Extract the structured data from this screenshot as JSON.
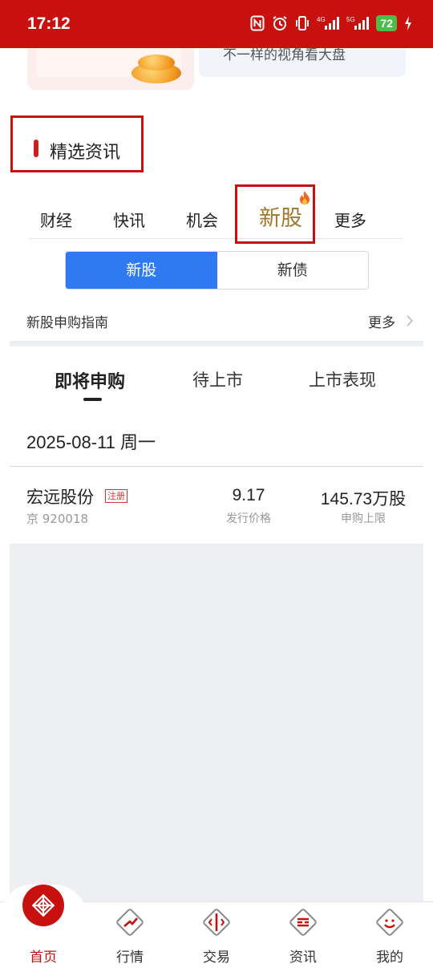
{
  "status_bar": {
    "time": "17:12",
    "battery": "72",
    "network_1": "4G",
    "network_2": "5G",
    "icons": [
      "nfc-icon",
      "alarm-icon",
      "vibrate-icon",
      "signal-icon",
      "signal-icon",
      "battery-icon",
      "charging-icon"
    ]
  },
  "banner": {
    "partial_text": "不一样的视角看大盘"
  },
  "section": {
    "title": "精选资讯"
  },
  "category_tabs": [
    {
      "label": "财经"
    },
    {
      "label": "快讯"
    },
    {
      "label": "机会"
    },
    {
      "label": "新股",
      "active": true,
      "badge_icon": "fire-icon"
    },
    {
      "label": "更多"
    }
  ],
  "segmented": {
    "options": [
      "新股",
      "新债"
    ],
    "selected": "新股"
  },
  "guide": {
    "label": "新股申购指南",
    "more": "更多"
  },
  "sub_tabs": {
    "items": [
      "即将申购",
      "待上市",
      "上市表现"
    ],
    "selected": "即将申购"
  },
  "list": {
    "date": "2025-08-11 周一",
    "rows": [
      {
        "name": "宏远股份",
        "tag": "注册",
        "code": "京 920018",
        "price": "9.17",
        "price_label": "发行价格",
        "limit": "145.73万股",
        "limit_label": "申购上限"
      }
    ]
  },
  "bottom_nav": [
    {
      "label": "首页",
      "active": true,
      "icon": "home-logo-icon"
    },
    {
      "label": "行情",
      "icon": "market-icon"
    },
    {
      "label": "交易",
      "icon": "trade-icon"
    },
    {
      "label": "资讯",
      "icon": "news-icon"
    },
    {
      "label": "我的",
      "icon": "profile-icon"
    }
  ],
  "colors": {
    "brand_red": "#c8100f",
    "accent_blue": "#2f7af0",
    "active_tab_gold": "#a0782d"
  }
}
